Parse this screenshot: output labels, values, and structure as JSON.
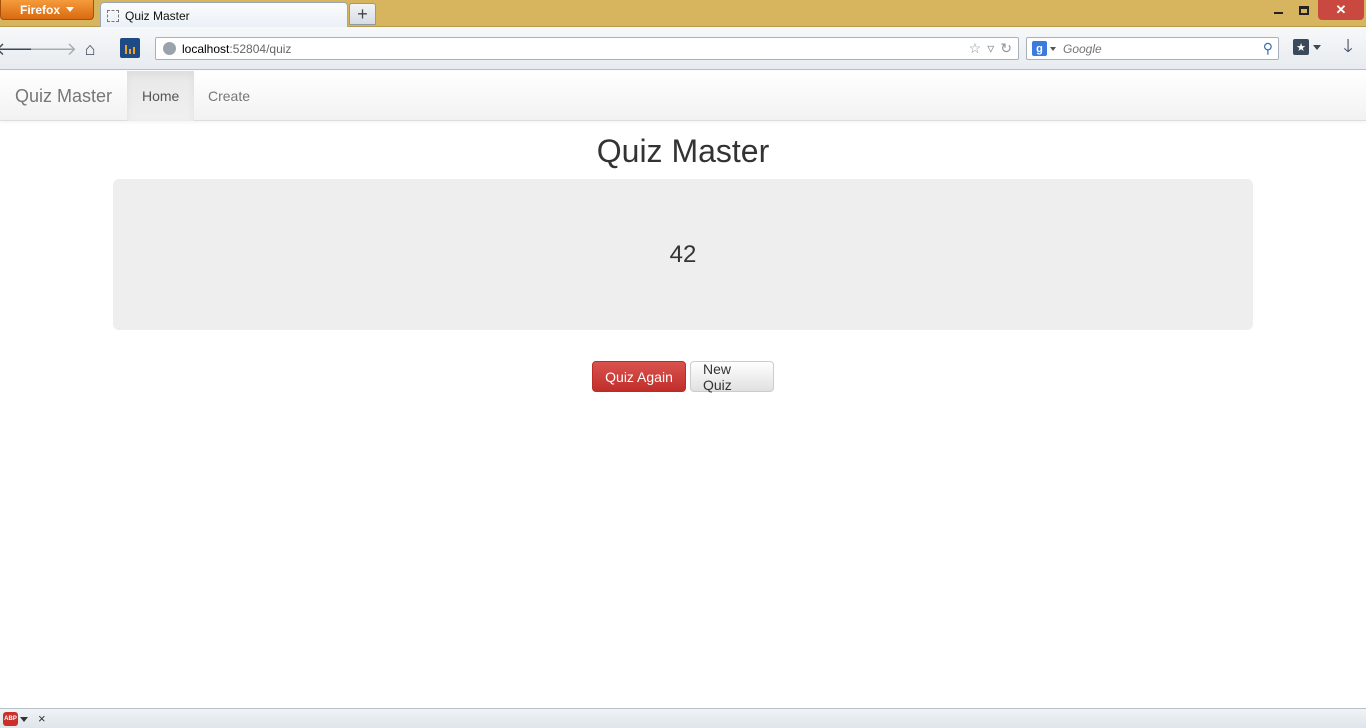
{
  "browser": {
    "app_button": "Firefox",
    "tab_title": "Quiz Master",
    "new_tab": "+",
    "url_host": "localhost",
    "url_rest": ":52804/quiz",
    "search_placeholder": "Google",
    "search_engine_icon": "g"
  },
  "navbar": {
    "brand": "Quiz Master",
    "items": [
      {
        "label": "Home",
        "active": true
      },
      {
        "label": "Create",
        "active": false
      }
    ]
  },
  "main": {
    "title": "Quiz Master",
    "answer": "42",
    "buttons": {
      "quiz_again": "Quiz Again",
      "new_quiz": "New Quiz"
    }
  },
  "addon_bar": {
    "abp_label": "ABP",
    "close": "×"
  },
  "colors": {
    "danger": "#d9534f",
    "jumbotron_bg": "#eeeeee",
    "titlebar": "#d6b55e",
    "firefox_button": "#e8821e"
  }
}
